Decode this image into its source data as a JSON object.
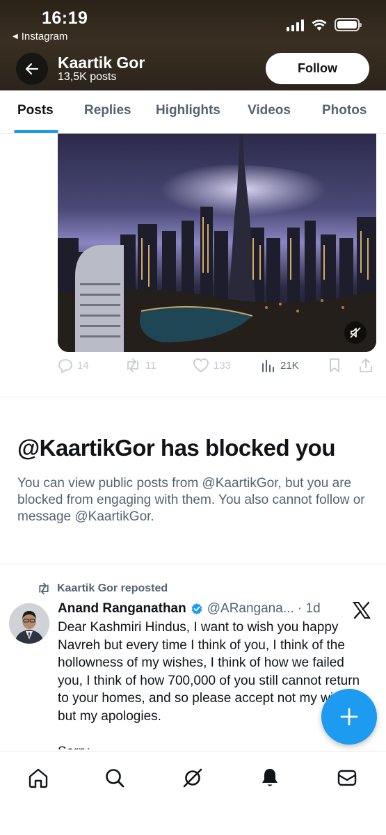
{
  "status_bar": {
    "time": "16:19",
    "back_app": "Instagram",
    "back_app_icon": "triangle-left-icon",
    "icons": [
      "signal-icon",
      "wifi-icon",
      "battery-icon"
    ]
  },
  "profile": {
    "name": "Kaartik Gor",
    "posts_count": "13,5K posts",
    "follow_label": "Follow",
    "back_icon": "arrow-left-icon"
  },
  "tabs": [
    {
      "label": "Posts",
      "active": true
    },
    {
      "label": "Replies",
      "active": false
    },
    {
      "label": "Highlights",
      "active": false
    },
    {
      "label": "Videos",
      "active": false
    },
    {
      "label": "Photos",
      "active": false
    }
  ],
  "post": {
    "media_icon": "mute-icon",
    "actions": {
      "replies": "14",
      "reposts": "11",
      "likes": "133",
      "views": "21K"
    }
  },
  "blocked": {
    "title": "@KaartikGor has blocked you",
    "text": "You can view public posts from @KaartikGor, but you are blocked from engaging with them. You also cannot follow or message @KaartikGor."
  },
  "repost": {
    "reposted_by": "Kaartik Gor reposted",
    "author_name": "Anand Ranganathan",
    "author_handle": "@ARangana... · 1d",
    "text": "Dear Kashmiri Hindus, I want to wish you happy Navreh but every time I think of you, I think of the hollowness of my wishes, I think of how we failed you, I think of how 700,000 of you still cannot return to your homes, and so please accept not my wishes but my apologies.\n\nSorry"
  },
  "colors": {
    "accent": "#1d9bf0",
    "text_primary": "#0f1419",
    "text_secondary": "#536471",
    "header_bg": "#3a2f22"
  },
  "bottom_nav": [
    "home-icon",
    "search-icon",
    "grok-icon",
    "notifications-icon",
    "messages-icon"
  ]
}
